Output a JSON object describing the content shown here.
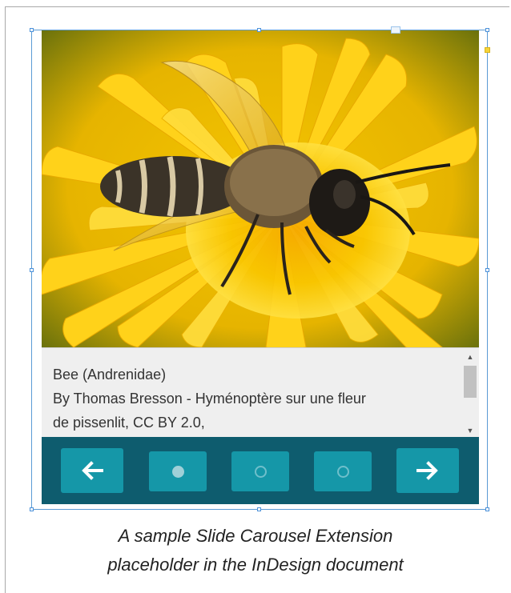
{
  "slide": {
    "image_description_icon": "bee-on-dandelion-photo",
    "caption_lines": [
      "Bee (Andrenidae)",
      "By Thomas Bresson - Hyménoptère sur une fleur",
      "de pissenlit, CC BY 2.0,"
    ]
  },
  "navigation": {
    "prev_icon": "arrow-left-icon",
    "next_icon": "arrow-right-icon",
    "prev_glyph": "🡐",
    "next_glyph": "🡒",
    "slide_count": 3,
    "active_slide": 1
  },
  "figure_caption": {
    "line1": "A sample Slide Carousel Extension",
    "line2": "placeholder in the InDesign document"
  },
  "colors": {
    "nav_bar": "#0e5c6e",
    "nav_button": "#1597a8",
    "selection": "#5b9bd5",
    "caption_bg": "#efefef"
  }
}
